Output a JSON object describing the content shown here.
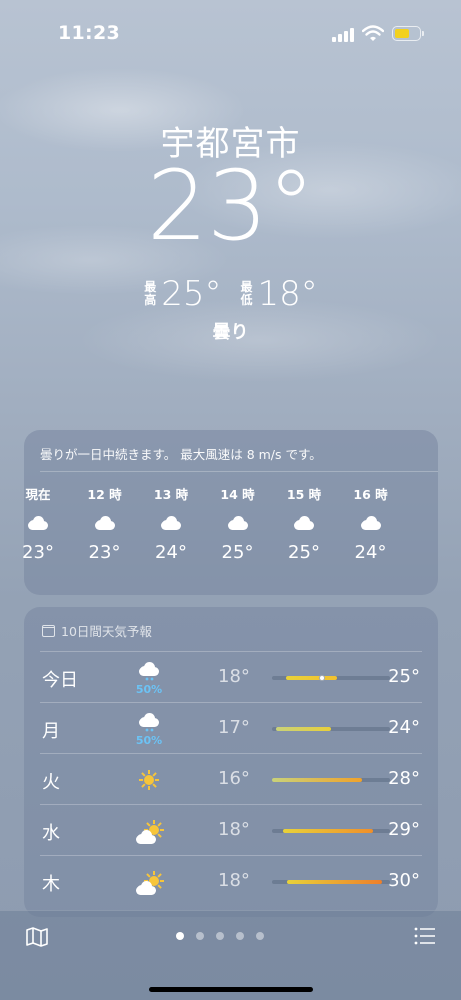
{
  "status_bar": {
    "time": "11:23",
    "battery_color": "#f2d11e"
  },
  "location": {
    "city": "宇都宮市",
    "temperature": "23°",
    "high_label": "最高",
    "high": "25°",
    "low_label": "最低",
    "low": "18°",
    "condition": "曇り"
  },
  "hourly": {
    "summary": "曇りが一日中続きます。 最大風速は 8 m/s です。",
    "hours": [
      {
        "time": "現在",
        "icon": "cloud-icon",
        "temp": "23°"
      },
      {
        "time": "12 時",
        "icon": "cloud-icon",
        "temp": "23°"
      },
      {
        "time": "13 時",
        "icon": "cloud-icon",
        "temp": "24°"
      },
      {
        "time": "14 時",
        "icon": "cloud-icon",
        "temp": "25°"
      },
      {
        "time": "15 時",
        "icon": "cloud-icon",
        "temp": "25°"
      },
      {
        "time": "16 時",
        "icon": "cloud-icon",
        "temp": "24°"
      }
    ]
  },
  "daily": {
    "title": "10日間天気予報",
    "days": [
      {
        "day": "今日",
        "icon": "rain-cloud-icon",
        "precip": "50%",
        "low": "18°",
        "high": "25°",
        "range_start": 0.12,
        "range_end": 0.55,
        "current": 0.42,
        "colors": [
          "#e8d23a",
          "#f2c12f"
        ]
      },
      {
        "day": "月",
        "icon": "rain-cloud-icon",
        "precip": "50%",
        "low": "17°",
        "high": "24°",
        "range_start": 0.03,
        "range_end": 0.5,
        "colors": [
          "#c9d27a",
          "#e8cf3a"
        ]
      },
      {
        "day": "火",
        "icon": "sun-icon",
        "precip": "",
        "low": "16°",
        "high": "28°",
        "range_start": 0.0,
        "range_end": 0.76,
        "colors": [
          "#c9d27a",
          "#f0a22a"
        ]
      },
      {
        "day": "水",
        "icon": "partly-cloudy-icon",
        "precip": "",
        "low": "18°",
        "high": "29°",
        "range_start": 0.09,
        "range_end": 0.86,
        "colors": [
          "#e8d23a",
          "#f08f2a"
        ]
      },
      {
        "day": "木",
        "icon": "partly-cloudy-icon",
        "precip": "",
        "low": "18°",
        "high": "30°",
        "range_start": 0.13,
        "range_end": 0.93,
        "colors": [
          "#e8d23a",
          "#ee7f2a"
        ]
      }
    ]
  },
  "page_indicator": {
    "count": 5,
    "active": 0
  }
}
